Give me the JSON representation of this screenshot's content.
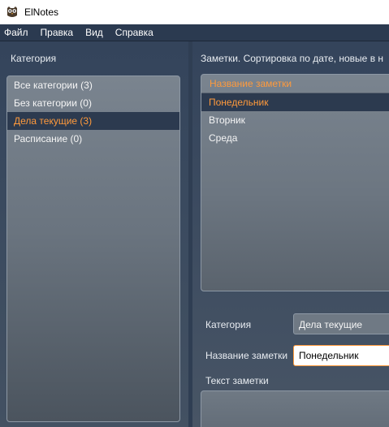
{
  "window": {
    "title": "ElNotes",
    "icon": "owl-icon"
  },
  "menu": {
    "items": [
      "Файл",
      "Правка",
      "Вид",
      "Справка"
    ]
  },
  "categories": {
    "header": "Категория",
    "items": [
      {
        "label": "Все категории (3)"
      },
      {
        "label": "Без категории (0)"
      },
      {
        "label": "Дела текущие (3)",
        "selected": true
      },
      {
        "label": "Расписание (0)"
      }
    ]
  },
  "notes": {
    "header": "Заметки. Сортировка по дате, новые в н",
    "column_title": "Название заметки",
    "items": [
      {
        "label": "Понедельник",
        "selected": true
      },
      {
        "label": "Вторник"
      },
      {
        "label": "Среда"
      }
    ]
  },
  "form": {
    "category_label": "Категория",
    "category_value": "Дела текущие",
    "name_label": "Название заметки",
    "name_value": "Понедельник",
    "text_label": "Текст заметки"
  },
  "colors": {
    "accent": "#ff9a3c",
    "panel": "#34445b",
    "menubar": "#2b3a50"
  }
}
